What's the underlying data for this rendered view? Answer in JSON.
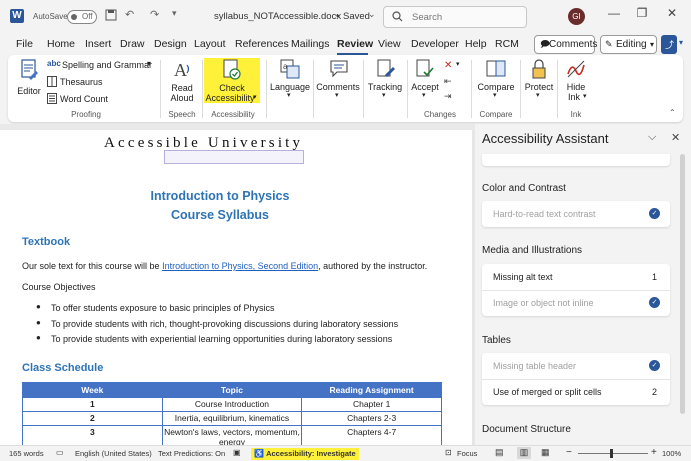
{
  "titlebar": {
    "autosave_label": "AutoSave",
    "autosave_state": "Off",
    "filename": "syllabus_NOTAccessible.docx",
    "saved": "Saved",
    "search_placeholder": "Search",
    "avatar_initials": "GI"
  },
  "tabs": [
    "File",
    "Home",
    "Insert",
    "Draw",
    "Design",
    "Layout",
    "References",
    "Mailings",
    "Review",
    "View",
    "Developer",
    "Help",
    "RCM"
  ],
  "active_tab": "Review",
  "top_buttons": {
    "comments": "Comments",
    "editing": "Editing"
  },
  "ribbon": {
    "editor": "Editor",
    "spelling": "Spelling and Grammar",
    "thesaurus": "Thesaurus",
    "word_count": "Word Count",
    "read_aloud_1": "Read",
    "read_aloud_2": "Aloud",
    "check_1": "Check",
    "check_2": "Accessibility",
    "language": "Language",
    "comments": "Comments",
    "tracking": "Tracking",
    "accept": "Accept",
    "compare": "Compare",
    "protect": "Protect",
    "hide_1": "Hide",
    "hide_2": "Ink",
    "groups": {
      "proofing": "Proofing",
      "speech": "Speech",
      "accessibility": "Accessibility",
      "changes": "Changes",
      "compare": "Compare",
      "ink": "Ink"
    }
  },
  "document": {
    "logo_text": "Accessible University",
    "title1": "Introduction to Physics",
    "title2": "Course Syllabus",
    "textbook_heading": "Textbook",
    "textbook_pre": "Our sole text for this course will be ",
    "textbook_link": "Introduction to Physics, Second Edition",
    "textbook_post": ", authored by the instructor.",
    "objectives_label": "Course Objectives",
    "bullets": [
      "To offer students exposure to basic principles of Physics",
      "To provide students with rich, thought-provoking discussions during laboratory sessions",
      "To provide students with experiential learning opportunities during laboratory sessions"
    ],
    "schedule_heading": "Class Schedule",
    "table": {
      "headers": [
        "Week",
        "Topic",
        "Reading Assignment"
      ],
      "rows": [
        [
          "1",
          "Course Introduction",
          "Chapter 1"
        ],
        [
          "2",
          "Inertia, equilibrium, kinematics",
          "Chapters 2-3"
        ],
        [
          "3",
          "Newton's laws, vectors, momentum, energy",
          "Chapters 4-7"
        ]
      ]
    }
  },
  "pane": {
    "title": "Accessibility Assistant",
    "sections": {
      "color": {
        "heading": "Color and Contrast",
        "items": [
          {
            "label": "Hard-to-read text contrast",
            "status": "done"
          }
        ]
      },
      "media": {
        "heading": "Media and Illustrations",
        "items": [
          {
            "label": "Missing alt text",
            "count": "1"
          },
          {
            "label": "Image or object not inline",
            "status": "done"
          }
        ]
      },
      "tables": {
        "heading": "Tables",
        "items": [
          {
            "label": "Missing table header",
            "status": "done"
          },
          {
            "label": "Use of merged or split cells",
            "count": "2"
          }
        ]
      },
      "structure": {
        "heading": "Document Structure"
      }
    }
  },
  "status": {
    "words": "165 words",
    "language": "English (United States)",
    "predictions": "Text Predictions: On",
    "accessibility": "Accessibility: Investigate",
    "focus": "Focus",
    "zoom": "100%"
  },
  "colors": {
    "accent": "#2b579a",
    "highlight": "#fff13a",
    "heading": "#2e74b5",
    "table_header": "#4472c4"
  }
}
